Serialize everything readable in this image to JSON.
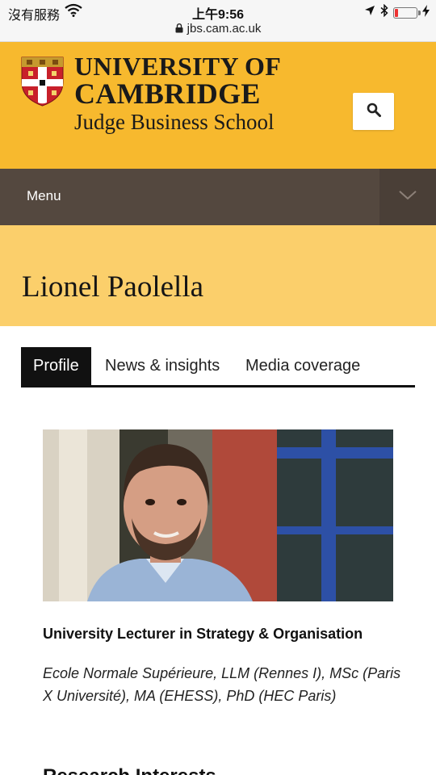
{
  "status_bar": {
    "carrier": "沒有服務",
    "time": "上午9:56",
    "url": "jbs.cam.ac.uk",
    "battery_level": 0.15
  },
  "header": {
    "brand_line1": "UNIVERSITY OF",
    "brand_line2": "CAMBRIDGE",
    "brand_line3": "Judge Business School",
    "search_icon": "search-icon",
    "colors": {
      "header_bg": "#f7b92e",
      "title_band_bg": "#fbcf6b",
      "menu_bg": "#54483f"
    }
  },
  "menu": {
    "label": "Menu",
    "toggle_icon": "chevron-down-icon"
  },
  "page": {
    "title": "Lionel Paolella"
  },
  "tabs": [
    {
      "label": "Profile",
      "active": true
    },
    {
      "label": "News & insights",
      "active": false
    },
    {
      "label": "Media coverage",
      "active": false
    }
  ],
  "profile": {
    "role": "University Lecturer in Strategy & Organisation",
    "qualifications": "Ecole Normale Supérieure, LLM (Rennes I), MSc (Paris X Université), MA (EHESS), PhD (HEC Paris)",
    "next_heading_partial": "Research Interests"
  }
}
